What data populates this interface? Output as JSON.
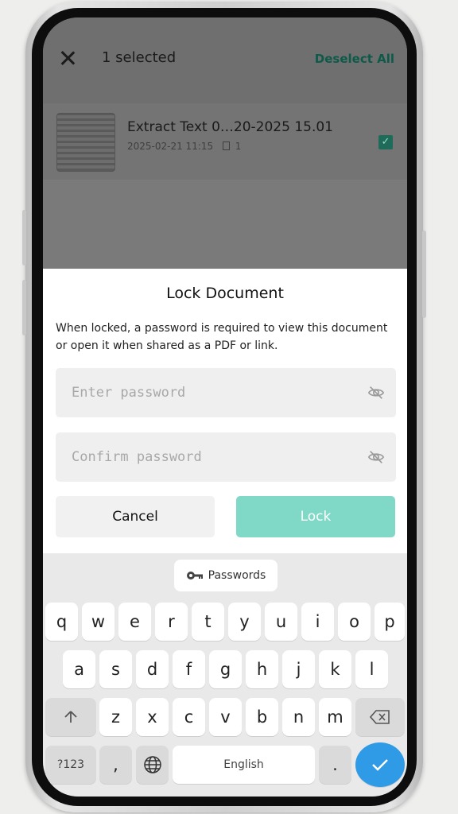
{
  "app_bar": {
    "selection_text": "1 selected",
    "deselect_label": "Deselect All"
  },
  "document": {
    "title": "Extract Text 0…20-2025 15.01",
    "date": "2025-02-21 11:15",
    "pages": "1"
  },
  "dialog": {
    "title": "Lock Document",
    "description": "When locked, a password is required to view this document or open it when shared as a PDF or link.",
    "password_placeholder": "Enter password",
    "confirm_placeholder": "Confirm password",
    "cancel_label": "Cancel",
    "lock_label": "Lock"
  },
  "keyboard": {
    "suggestion_label": "Passwords",
    "row1": [
      "q",
      "w",
      "e",
      "r",
      "t",
      "y",
      "u",
      "i",
      "o",
      "p"
    ],
    "row2": [
      "a",
      "s",
      "d",
      "f",
      "g",
      "h",
      "j",
      "k",
      "l"
    ],
    "row3": [
      "z",
      "x",
      "c",
      "v",
      "b",
      "n",
      "m"
    ],
    "symbols_label": "?123",
    "comma": ",",
    "space_label": "English",
    "period": "."
  },
  "colors": {
    "accent": "#7fd9c6",
    "enter_key": "#2f9be6"
  }
}
